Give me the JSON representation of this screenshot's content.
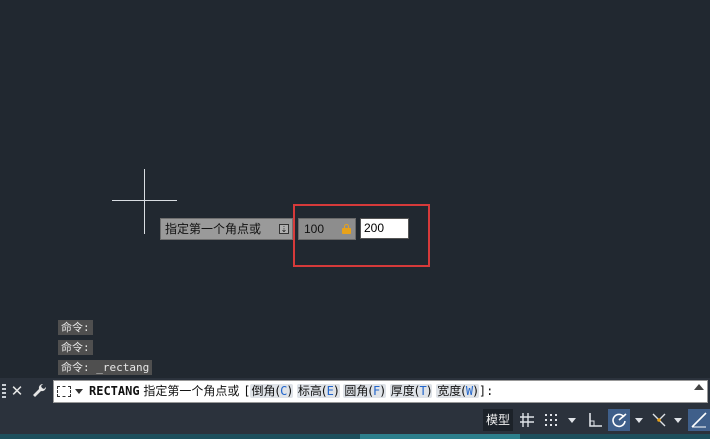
{
  "canvas": {
    "tooltip": {
      "text": "指定第一个角点或",
      "arrow": "⇣"
    },
    "coord_x": "100",
    "coord_y": "200"
  },
  "history": [
    "命令:",
    "命令:",
    "命令: _rectang"
  ],
  "command_line": {
    "keyword": "RECTANG",
    "prompt": "指定第一个角点或",
    "open_bracket": "[",
    "options": [
      {
        "label": "倒角(",
        "key": "C",
        "end": ")"
      },
      {
        "label": "标高(",
        "key": "E",
        "end": ")"
      },
      {
        "label": "圆角(",
        "key": "F",
        "end": ")"
      },
      {
        "label": "厚度(",
        "key": "T",
        "end": ")"
      },
      {
        "label": "宽度(",
        "key": "W",
        "end": ")"
      }
    ],
    "close": "]:",
    "close_icon": "✕"
  },
  "status_bar": {
    "model_label": "模型"
  },
  "colors": {
    "canvas_bg": "#212830",
    "highlight_box": "#d63a3a",
    "active_toggle": "#3f5f8a",
    "option_key": "#2266cc"
  }
}
